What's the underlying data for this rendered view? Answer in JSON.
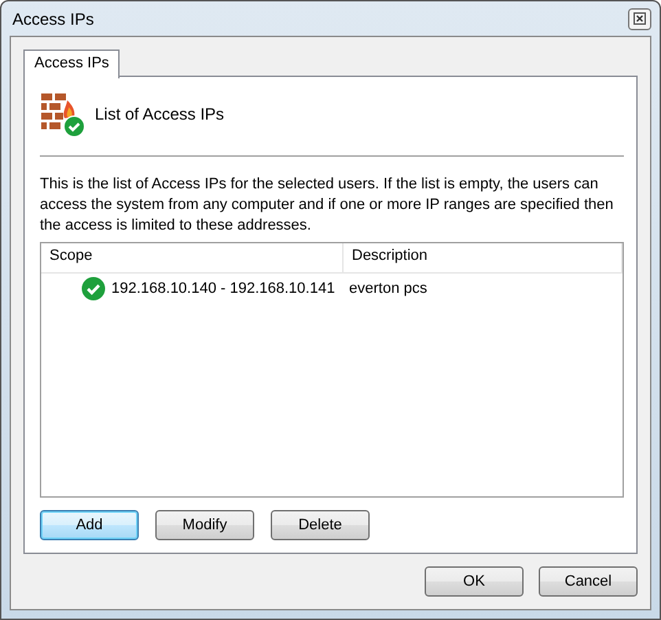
{
  "window": {
    "title": "Access IPs"
  },
  "tabs": [
    {
      "label": "Access IPs",
      "selected": true
    }
  ],
  "header": {
    "title": "List of Access IPs"
  },
  "description": "This is the list of Access IPs for the selected users. If the list is empty, the users can access the system from any computer and if one or more IP ranges are specified then the access is limited to these addresses.",
  "table": {
    "columns": [
      "Scope",
      "Description"
    ],
    "rows": [
      {
        "scope": "192.168.10.140 - 192.168.10.141",
        "description": "everton pcs",
        "enabled": true
      }
    ]
  },
  "list_buttons": [
    {
      "label": "Add",
      "default": true
    },
    {
      "label": "Modify",
      "default": false
    },
    {
      "label": "Delete",
      "default": false
    }
  ],
  "dialog_buttons": [
    {
      "label": "OK",
      "default": false
    },
    {
      "label": "Cancel",
      "default": false
    }
  ]
}
